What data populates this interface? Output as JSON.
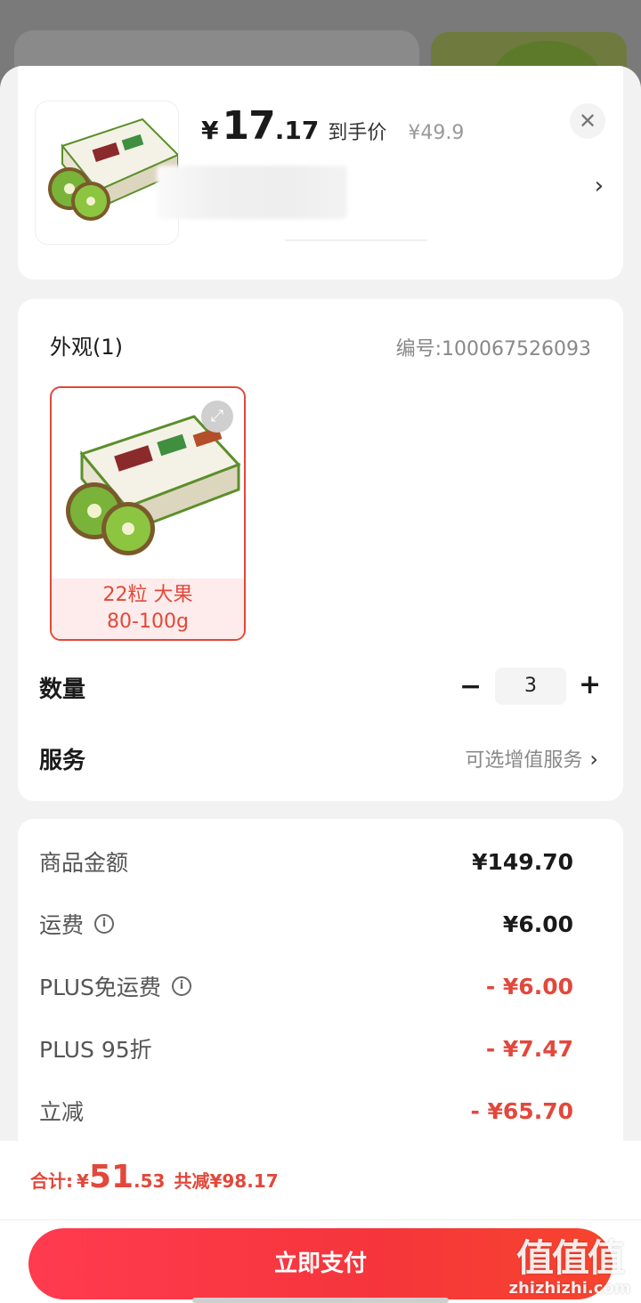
{
  "product": {
    "price_currency": "¥",
    "price_int": "17",
    "price_dec": ".17",
    "price_tag": "到手价",
    "original_price": "¥49.9"
  },
  "spec": {
    "title": "外观(1)",
    "code": "编号:100067526093",
    "option_label_line1": "22粒 大果",
    "option_label_line2": "80-100g"
  },
  "quantity": {
    "label": "数量",
    "minus": "−",
    "value": "3",
    "plus": "+"
  },
  "service": {
    "label": "服务",
    "value": "可选增值服务",
    "chevron": "›"
  },
  "fees": [
    {
      "label": "商品金额",
      "value": "¥149.70",
      "info": false,
      "red": false
    },
    {
      "label": "运费",
      "value": "¥6.00",
      "info": true,
      "red": false
    },
    {
      "label": "PLUS免运费",
      "value": "- ¥6.00",
      "info": true,
      "red": true
    },
    {
      "label": "PLUS 95折",
      "value": "- ¥7.47",
      "info": false,
      "red": true
    },
    {
      "label": "立减",
      "value": "- ¥65.70",
      "info": false,
      "red": true
    }
  ],
  "footer": {
    "total_label": "合计:",
    "total_currency": "¥",
    "total_int": "51",
    "total_dec": ".53",
    "saved": "共减¥98.17",
    "pay_button": "立即支付"
  },
  "watermark": {
    "main": "值值值",
    "sub": "zhizhizhi.com"
  },
  "icons": {
    "close": "close-icon",
    "expand": "expand-icon",
    "info": "info-icon",
    "chevron": "chevron-right-icon"
  },
  "colors": {
    "accent_red": "#e2483b",
    "pay_button": "#f5353b"
  }
}
